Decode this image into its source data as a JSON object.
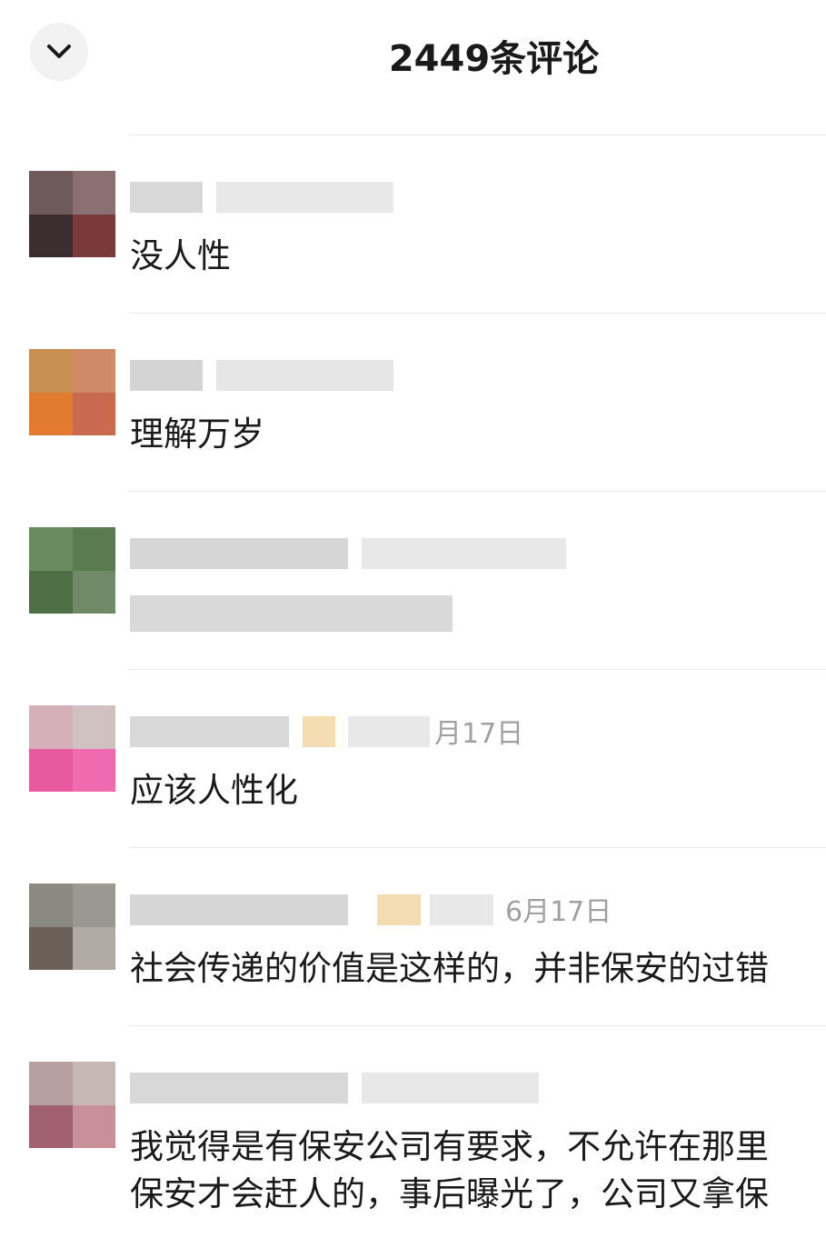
{
  "header": {
    "collapse_icon": "chevron-down-icon",
    "title": "2449条评论"
  },
  "comments": [
    {
      "text": "没人性",
      "date": ""
    },
    {
      "text": "理解万岁",
      "date": ""
    },
    {
      "text": "",
      "date": ""
    },
    {
      "text": "应该人性化",
      "date": "月17日"
    },
    {
      "text": "社会传递的价值是这样的，并非保安的过错",
      "date": "6月17日"
    },
    {
      "text": "我觉得是有保安公司有要求，不允许在那里",
      "text_line2": "保安才会赶人的，事后曝光了，公司又拿保",
      "date": ""
    }
  ]
}
